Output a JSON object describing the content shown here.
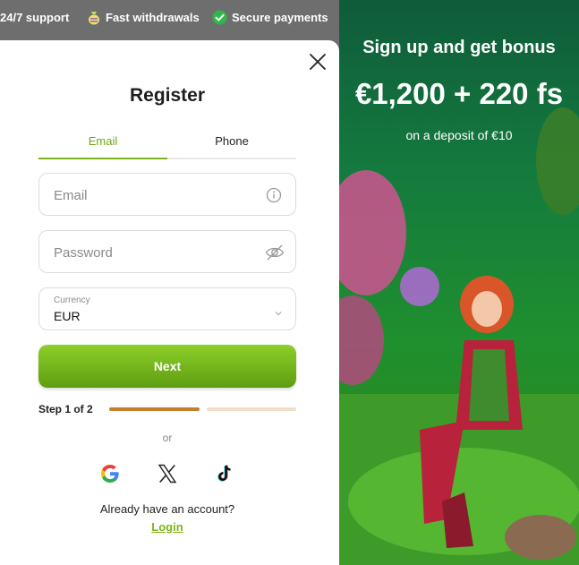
{
  "topbar": {
    "items": [
      {
        "label": "24/7 support",
        "icon": "headset-icon"
      },
      {
        "label": "Fast withdrawals",
        "icon": "money-bag-icon"
      },
      {
        "label": "Secure payments",
        "icon": "check-circle-icon"
      }
    ]
  },
  "modal": {
    "title": "Register",
    "tabs": [
      {
        "label": "Email",
        "active": true
      },
      {
        "label": "Phone",
        "active": false
      }
    ],
    "email_placeholder": "Email",
    "password_placeholder": "Password",
    "currency_label": "Currency",
    "currency_value": "EUR",
    "next_label": "Next",
    "step_text": "Step 1 of 2",
    "step_progress": 0.5,
    "or_text": "or",
    "social": [
      "google-icon",
      "x-icon",
      "tiktok-icon"
    ],
    "already_text": "Already have an account?",
    "login_label": "Login"
  },
  "promo": {
    "headline": "Sign up and get bonus",
    "amount": "€1,200 + 220 fs",
    "subline": "on a deposit of €10"
  },
  "colors": {
    "accent": "#7cb51b",
    "progress_done": "#c87d2e",
    "progress_todo": "#f0dfc8",
    "topbar_bg": "#6e6e6e"
  }
}
